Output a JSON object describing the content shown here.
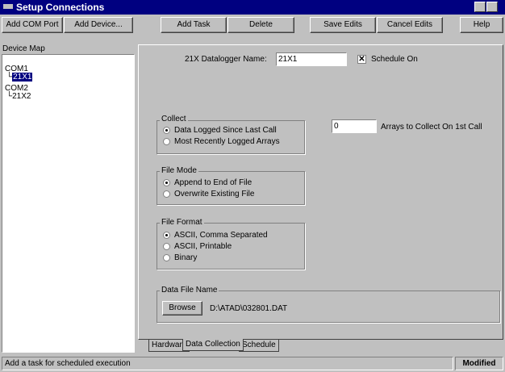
{
  "window": {
    "title": "Setup Connections"
  },
  "toolbar": {
    "add_com_port": "Add COM Port",
    "add_device": "Add Device...",
    "add_task": "Add Task",
    "delete": "Delete",
    "save_edits": "Save Edits",
    "cancel_edits": "Cancel Edits",
    "help": "Help"
  },
  "device_map": {
    "label": "Device Map",
    "items": [
      "COM1",
      "21X1",
      "COM2",
      "21X2"
    ]
  },
  "datalogger": {
    "name_label": "21X Datalogger Name:",
    "name_value": "21X1",
    "schedule_label": "Schedule On",
    "schedule_checked": true
  },
  "collect": {
    "label": "Collect",
    "options": [
      "Data Logged Since Last Call",
      "Most Recently Logged Arrays"
    ],
    "arrays_value": "0",
    "arrays_label": "Arrays to Collect On 1st Call"
  },
  "file_mode": {
    "label": "File Mode",
    "options": [
      "Append to End of File",
      "Overwrite Existing File"
    ]
  },
  "file_format": {
    "label": "File Format",
    "options": [
      "ASCII, Comma Separated",
      "ASCII, Printable",
      "Binary"
    ]
  },
  "data_file": {
    "label": "Data File Name",
    "browse": "Browse",
    "path": "D:\\ATAD\\032801.DAT"
  },
  "tabs": [
    "Hardware",
    "Data Collection",
    "Schedule"
  ],
  "status": {
    "message": "Add a task for scheduled execution",
    "state": "Modified"
  }
}
